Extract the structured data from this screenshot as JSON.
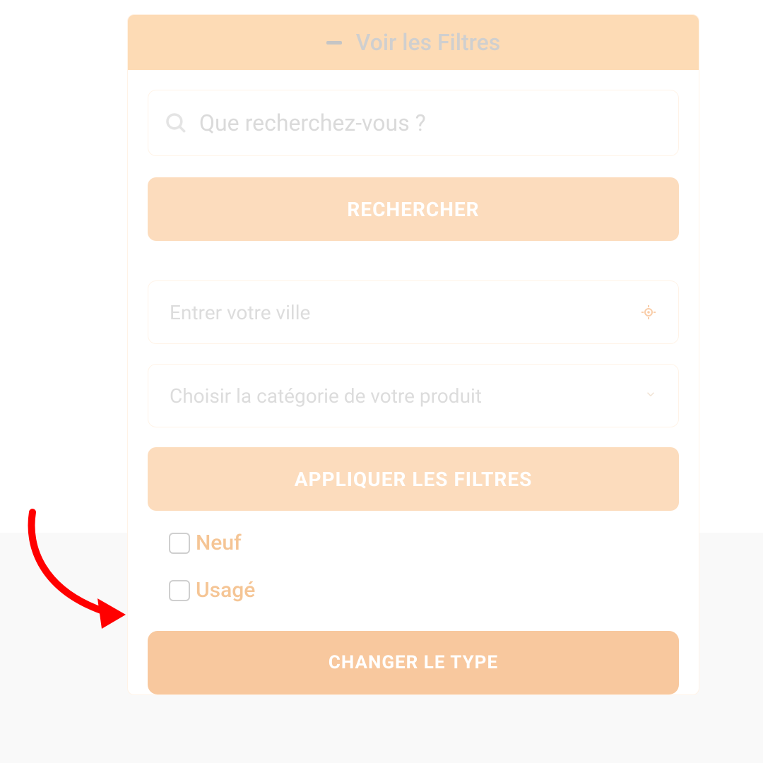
{
  "header": {
    "title": "Voir les Filtres"
  },
  "search": {
    "placeholder": "Que recherchez-vous ?",
    "button_label": "RECHERCHER"
  },
  "city": {
    "placeholder": "Entrer votre ville"
  },
  "category": {
    "placeholder": "Choisir la catégorie de votre produit"
  },
  "apply_filters_label": "APPLIQUER LES FILTRES",
  "condition_options": [
    {
      "label": "Neuf"
    },
    {
      "label": "Usagé"
    }
  ],
  "change_type_label": "CHANGER LE TYPE"
}
